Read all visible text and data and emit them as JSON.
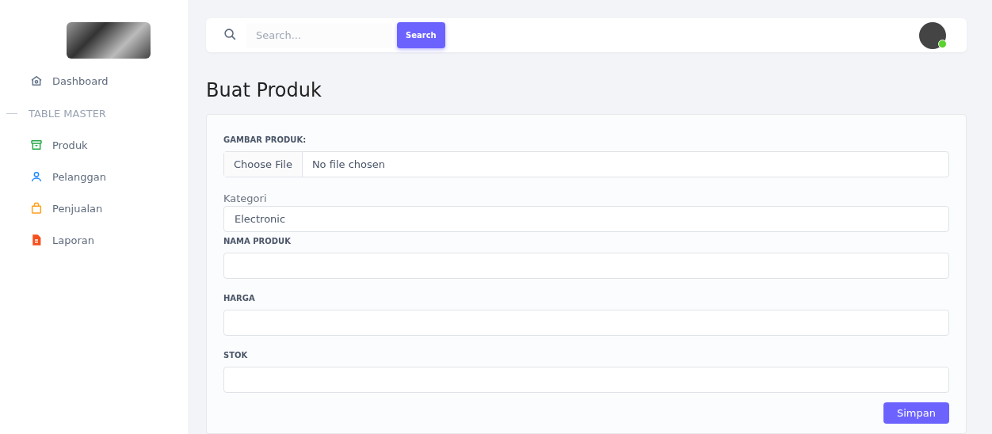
{
  "sidebar": {
    "items": [
      {
        "label": "Dashboard",
        "kind": "home",
        "color": "#64748b"
      }
    ],
    "section": "TABLE MASTER",
    "master_items": [
      {
        "label": "Produk",
        "kind": "archive",
        "color": "#22a846"
      },
      {
        "label": "Pelanggan",
        "kind": "user",
        "color": "#1e88ff"
      },
      {
        "label": "Penjualan",
        "kind": "bag",
        "color": "#ff9f1a"
      },
      {
        "label": "Laporan",
        "kind": "file",
        "color": "#f4511e"
      }
    ]
  },
  "topbar": {
    "search": {
      "placeholder": "Search..."
    },
    "search_button": "Search",
    "avatar": {
      "online": true
    }
  },
  "page_title": "Buat Produk",
  "form": {
    "fields": [
      {
        "kind": "file",
        "label": "GAMBAR PRODUK:",
        "button": "Choose File",
        "value": "No file chosen"
      },
      {
        "kind": "select",
        "label": "Kategori",
        "value": "Electronic"
      },
      {
        "kind": "text",
        "label": "NAMA PRODUK"
      },
      {
        "kind": "text",
        "label": "HARGA"
      },
      {
        "kind": "text",
        "label": "STOK"
      }
    ],
    "submit": "Simpan"
  }
}
